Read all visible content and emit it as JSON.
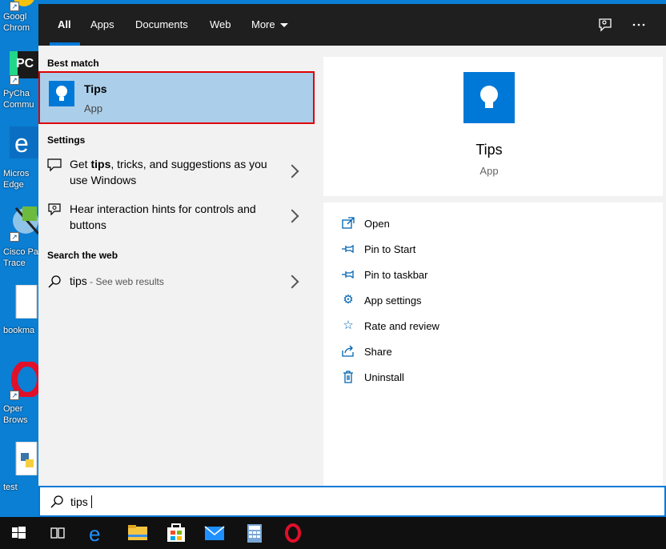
{
  "desktop": {
    "icons": [
      {
        "label": "Googl Chrom",
        "icon": "chrome-icon"
      },
      {
        "label": "PyCha Commu",
        "icon": "pycharm-icon"
      },
      {
        "label": "Micros Edge",
        "icon": "edge-icon"
      },
      {
        "label": "Cisco Pa Trace",
        "icon": "packet-tracer-icon"
      },
      {
        "label": "bookma",
        "icon": "file-icon"
      },
      {
        "label": "Oper Brows",
        "icon": "opera-icon"
      },
      {
        "label": "test",
        "icon": "python-file-icon"
      }
    ]
  },
  "tabs": [
    {
      "label": "All",
      "active": true
    },
    {
      "label": "Apps"
    },
    {
      "label": "Documents"
    },
    {
      "label": "Web"
    },
    {
      "label": "More"
    }
  ],
  "topbar": {
    "feedback_icon": "feedback-icon",
    "options_icon": "more-options-icon"
  },
  "left": {
    "best_match_header": "Best match",
    "best_match": {
      "title": "Tips",
      "subtitle": "App"
    },
    "settings_header": "Settings",
    "settings": [
      {
        "pre": "Get ",
        "bold": "tips",
        "post": ", tricks, and suggestions as you use Windows",
        "icon": "speech-bubble-icon"
      },
      {
        "pre": "Hear interaction hints for controls and buttons",
        "bold": "",
        "post": "",
        "icon": "interaction-hint-icon"
      }
    ],
    "web_header": "Search the web",
    "web": {
      "query": "tips",
      "suffix": " - See web results"
    }
  },
  "preview": {
    "title": "Tips",
    "subtitle": "App",
    "actions": [
      {
        "label": "Open",
        "icon": "open-icon"
      },
      {
        "label": "Pin to Start",
        "icon": "pin-icon"
      },
      {
        "label": "Pin to taskbar",
        "icon": "pin-icon"
      },
      {
        "label": "App settings",
        "icon": "gear-icon"
      },
      {
        "label": "Rate and review",
        "icon": "star-icon"
      },
      {
        "label": "Share",
        "icon": "share-icon"
      },
      {
        "label": "Uninstall",
        "icon": "trash-icon"
      }
    ]
  },
  "search": {
    "value": "tips"
  },
  "taskbar": {
    "items": [
      "windows-start-icon",
      "task-view-icon",
      "edge-icon",
      "file-explorer-icon",
      "store-icon",
      "mail-icon",
      "calculator-icon",
      "opera-icon"
    ]
  },
  "colors": {
    "accent": "#0078d7",
    "highlight": "#abcfea",
    "selection_border": "#e00000",
    "desktop": "#0a7fd4"
  }
}
